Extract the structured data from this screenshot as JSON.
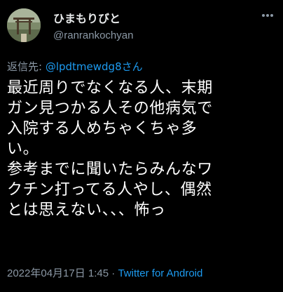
{
  "author": {
    "name": "ひまもりびと",
    "handle": "@ranrankochyan",
    "avatar_icon": "shrine-gate-avatar"
  },
  "more_icon": "more-dots-icon",
  "reply": {
    "prefix": "返信先: ",
    "mention": "@lpdtmewdg8さん"
  },
  "body_lines": [
    "最近周りでなくなる人、末期",
    "ガン見つかる人その他病気で",
    "入院する人めちゃくちゃ多",
    "い。",
    "参考までに聞いたらみんなワ",
    "クチン打ってる人やし、偶然",
    "とは思えない、、、怖っ"
  ],
  "meta": {
    "timestamp": "2022年04月17日 1:45",
    "separator": " · ",
    "source": "Twitter for Android"
  },
  "colors": {
    "background": "#000000",
    "text": "#ffffff",
    "secondary": "#8b98a5",
    "link": "#1d9bf0"
  }
}
